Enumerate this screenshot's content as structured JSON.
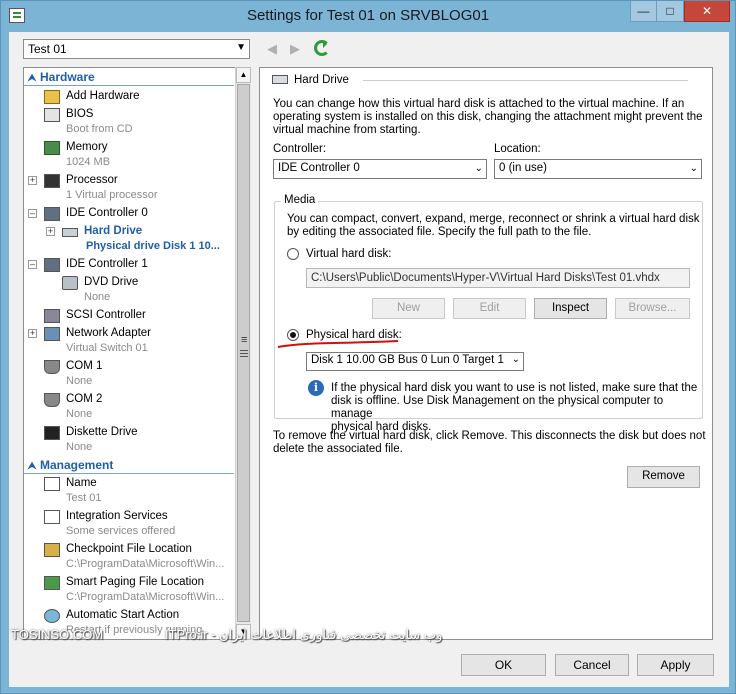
{
  "window": {
    "title": "Settings for Test 01 on SRVBLOG01"
  },
  "vm_selector": {
    "value": "Test 01"
  },
  "tree": {
    "hardware_header": "Hardware",
    "management_header": "Management",
    "items": {
      "add_hardware": "Add Hardware",
      "bios": "BIOS",
      "bios_sub": "Boot from CD",
      "memory": "Memory",
      "memory_sub": "1024 MB",
      "processor": "Processor",
      "processor_sub": "1 Virtual processor",
      "ide0": "IDE Controller 0",
      "hard_drive": "Hard Drive",
      "hard_drive_sub": "Physical drive Disk 1 10...",
      "ide1": "IDE Controller 1",
      "dvd": "DVD Drive",
      "dvd_sub": "None",
      "scsi": "SCSI Controller",
      "net": "Network Adapter",
      "net_sub": "Virtual Switch 01",
      "com1": "COM 1",
      "com1_sub": "None",
      "com2": "COM 2",
      "com2_sub": "None",
      "diskette": "Diskette Drive",
      "diskette_sub": "None",
      "name": "Name",
      "name_sub": "Test 01",
      "integration": "Integration Services",
      "integration_sub": "Some services offered",
      "checkpoint": "Checkpoint File Location",
      "checkpoint_sub": "C:\\ProgramData\\Microsoft\\Win...",
      "smartpaging": "Smart Paging File Location",
      "smartpaging_sub": "C:\\ProgramData\\Microsoft\\Win...",
      "autostart": "Automatic Start Action",
      "autostart_sub": "Restart if previously running"
    }
  },
  "panel": {
    "title": "Hard Drive",
    "intro_line1": "You can change how this virtual hard disk is attached to the virtual machine. If an",
    "intro_line2": "operating system is installed on this disk, changing the attachment might prevent the",
    "intro_line3": "virtual machine from starting.",
    "controller_label": "Controller:",
    "controller_value": "IDE Controller 0",
    "location_label": "Location:",
    "location_value": "0 (in use)",
    "media_title": "Media",
    "media_desc1": "You can compact, convert, expand, merge, reconnect or shrink a virtual hard disk",
    "media_desc2": "by editing the associated file. Specify the full path to the file.",
    "vhd_label": "Virtual hard disk:",
    "vhd_path": "C:\\Users\\Public\\Documents\\Hyper-V\\Virtual Hard Disks\\Test 01.vhdx",
    "btn_new": "New",
    "btn_edit": "Edit",
    "btn_inspect": "Inspect",
    "btn_browse": "Browse...",
    "phys_label": "Physical hard disk:",
    "phys_value": "Disk 1 10.00 GB Bus 0 Lun 0 Target 1",
    "info1": "If the physical hard disk you want to use is not listed, make sure that the",
    "info2": "disk is offline. Use Disk Management on the physical computer to manage",
    "info3": "physical hard disks.",
    "remove_desc1": "To remove the virtual hard disk, click Remove. This disconnects the disk but does not",
    "remove_desc2": "delete the associated file.",
    "btn_remove": "Remove"
  },
  "footer": {
    "ok": "OK",
    "cancel": "Cancel",
    "apply": "Apply"
  },
  "watermark": {
    "left": "TOSINSO.COM",
    "right": "وب سایت تخصصی فناوری اطلاعات ایران - ITPro.ir"
  },
  "colors": {
    "accent": "#1f5fa8",
    "title_bg": "#7cb4d6",
    "annotation": "#d01010"
  }
}
